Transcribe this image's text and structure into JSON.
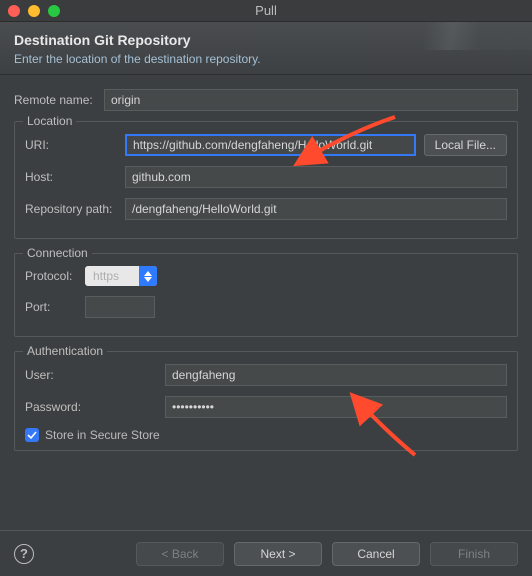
{
  "window": {
    "title": "Pull"
  },
  "header": {
    "title": "Destination Git Repository",
    "subtitle": "Enter the location of the destination repository."
  },
  "remote_name": {
    "label": "Remote name:",
    "value": "origin"
  },
  "location": {
    "legend": "Location",
    "uri": {
      "label": "URI:",
      "value": "https://github.com/dengfaheng/HelloWorld.git"
    },
    "local_file_btn": "Local File...",
    "host": {
      "label": "Host:",
      "value": "github.com"
    },
    "repo_path": {
      "label": "Repository path:",
      "value": "/dengfaheng/HelloWorld.git"
    }
  },
  "connection": {
    "legend": "Connection",
    "protocol": {
      "label": "Protocol:",
      "value": "https"
    },
    "port": {
      "label": "Port:",
      "value": ""
    }
  },
  "auth": {
    "legend": "Authentication",
    "user": {
      "label": "User:",
      "value": "dengfaheng"
    },
    "password": {
      "label": "Password:",
      "value": "••••••••••"
    },
    "store": {
      "label": "Store in Secure Store",
      "checked": true
    }
  },
  "footer": {
    "back": "< Back",
    "next": "Next >",
    "cancel": "Cancel",
    "finish": "Finish"
  }
}
